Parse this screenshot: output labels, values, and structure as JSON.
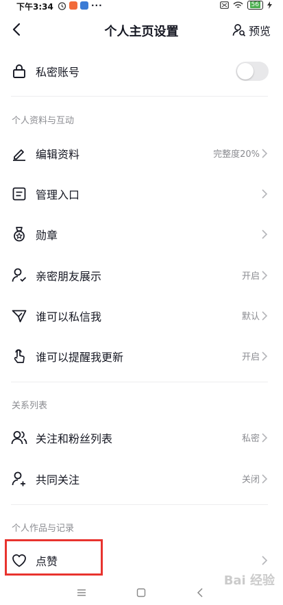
{
  "status_bar": {
    "time": "下午3:34",
    "battery": "56"
  },
  "header": {
    "title": "个人主页设置",
    "preview_label": "预览"
  },
  "private_account": {
    "label": "私密账号",
    "enabled": false
  },
  "sections": {
    "profile_interaction": "个人资料与互动",
    "relations": "关系列表",
    "works_records": "个人作品与记录"
  },
  "rows": {
    "edit_profile": {
      "label": "编辑资料",
      "value": "完整度20%"
    },
    "manage_entry": {
      "label": "管理入口",
      "value": ""
    },
    "badges": {
      "label": "勋章",
      "value": ""
    },
    "close_friends": {
      "label": "亲密朋友展示",
      "value": "开启"
    },
    "who_dm": {
      "label": "谁可以私信我",
      "value": "默认"
    },
    "who_remind": {
      "label": "谁可以提醒我更新",
      "value": "开启"
    },
    "follow_fans": {
      "label": "关注和粉丝列表",
      "value": "私密"
    },
    "mutual_follow": {
      "label": "共同关注",
      "value": "关闭"
    },
    "likes": {
      "label": "点赞",
      "value": ""
    }
  },
  "watermark": "Bai 经验",
  "colors": {
    "highlight": "#e8332e",
    "secondary_text": "#8a8b90",
    "toggle_off": "#e8e8ea"
  }
}
